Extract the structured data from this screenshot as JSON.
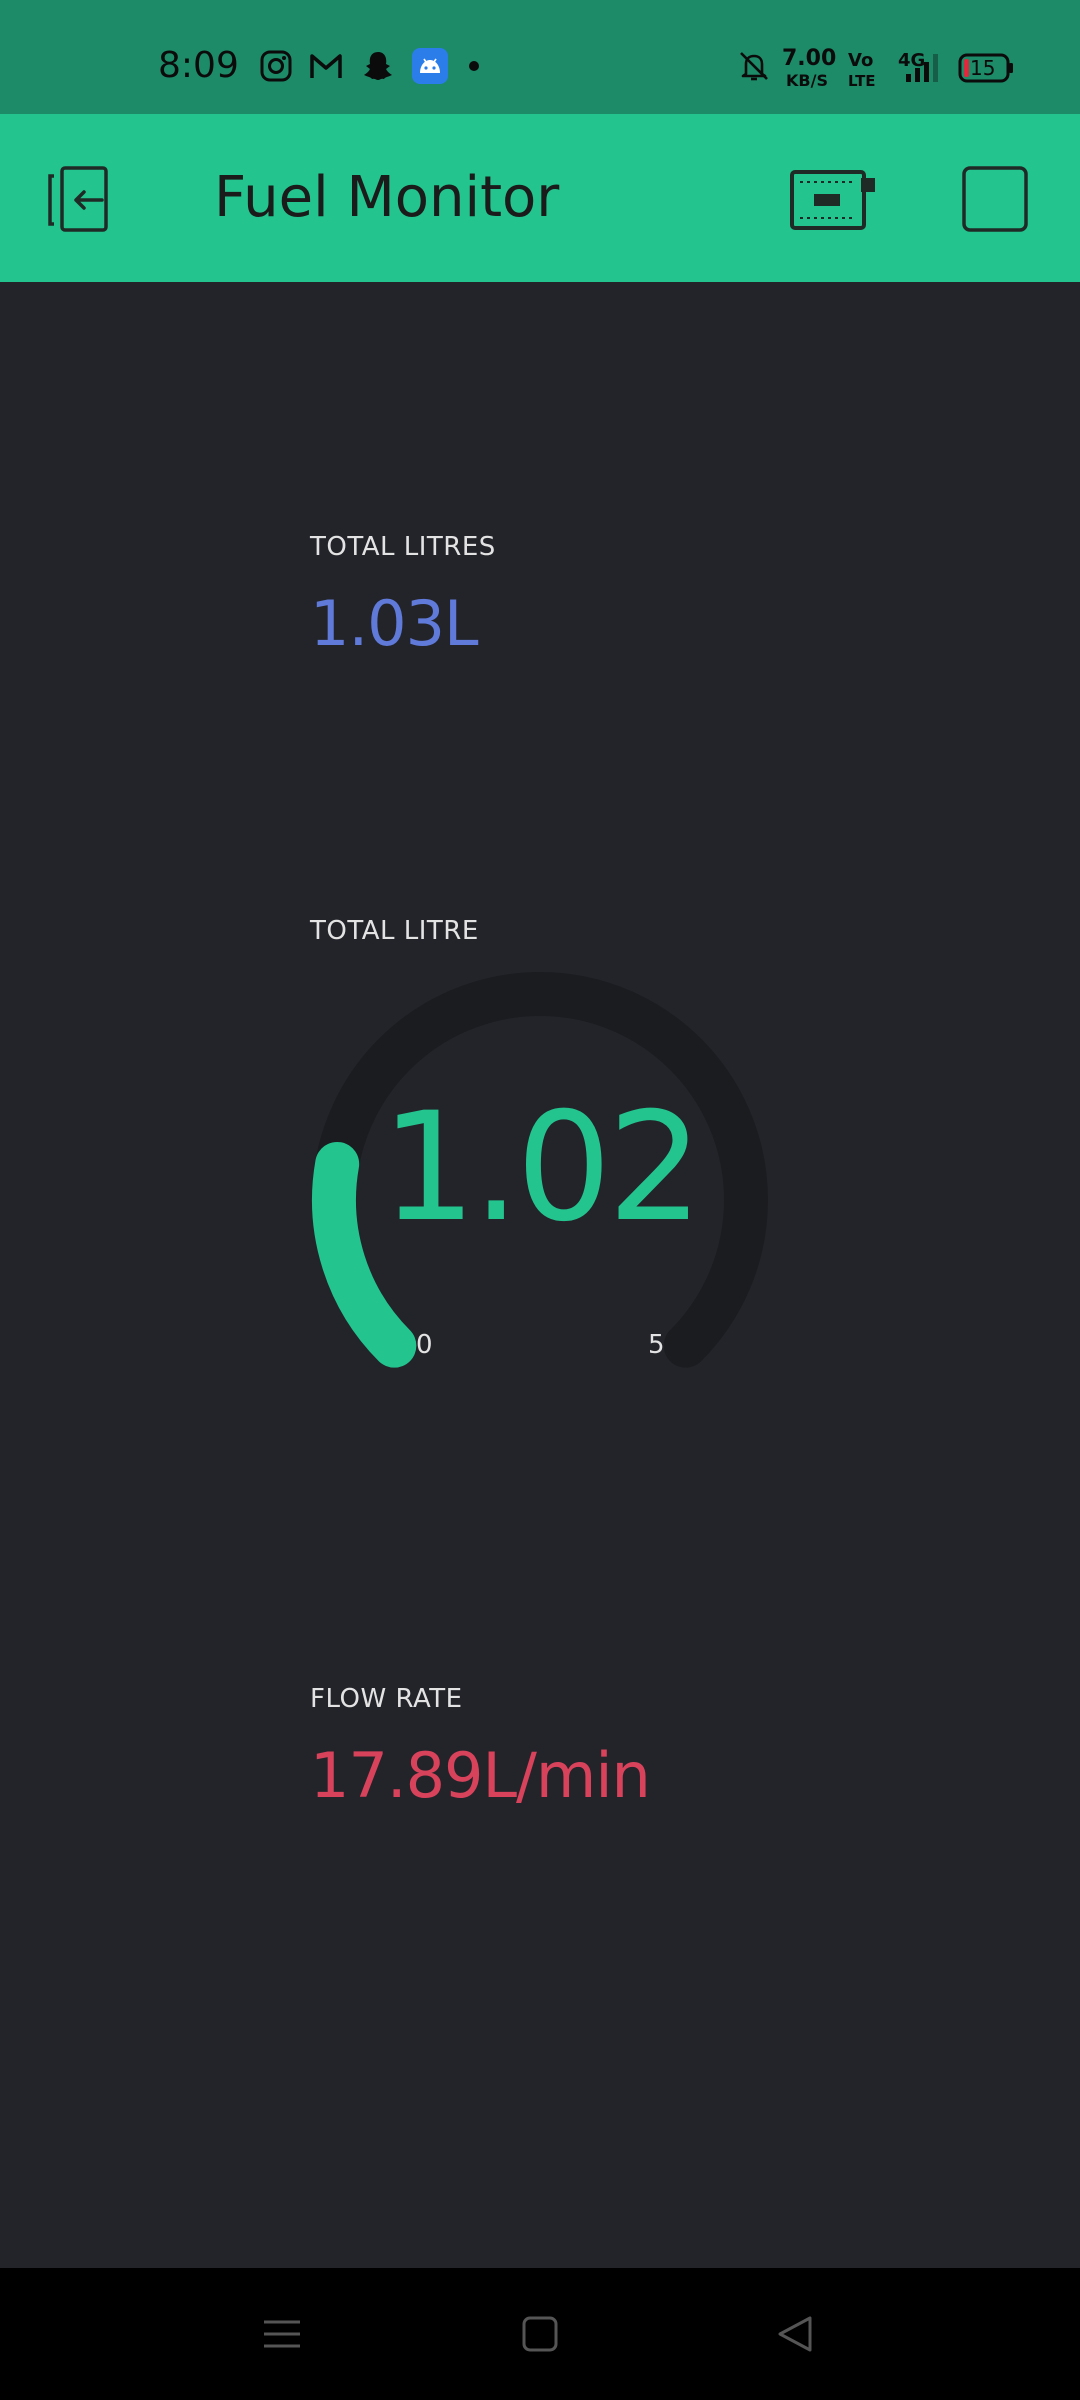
{
  "status_bar": {
    "time": "8:09",
    "network_speed": "7.00",
    "network_speed_unit": "KB/S",
    "volte": "Vo",
    "lte": "LTE",
    "network_type": "4G",
    "battery": "15",
    "notification_icons": [
      "instagram-icon",
      "gmail-icon",
      "snapchat-icon",
      "android-icon",
      "dot-icon"
    ],
    "system_icons": [
      "bell-muted-icon",
      "signal-icon",
      "battery-icon"
    ]
  },
  "app_bar": {
    "title": "Fuel Monitor",
    "color": "#23c48e",
    "left_icon": "exit-icon",
    "right_icons": [
      "device-board-icon",
      "square-icon"
    ]
  },
  "widgets": {
    "total_litres": {
      "label": "TOTAL LITRES",
      "value": "1.03L",
      "color": "#5f7ad8"
    },
    "gauge": {
      "label": "TOTAL LITRE",
      "value": "1.02",
      "min": "0",
      "max": "5",
      "level": 0.204,
      "color": "#23c48e",
      "track_color": "#1b1c20"
    },
    "flow_rate": {
      "label": "FLOW RATE",
      "value": "17.89L/min",
      "color": "#d8425b"
    }
  },
  "nav_bar": {
    "icons": [
      "menu-icon",
      "home-icon",
      "back-icon"
    ]
  }
}
